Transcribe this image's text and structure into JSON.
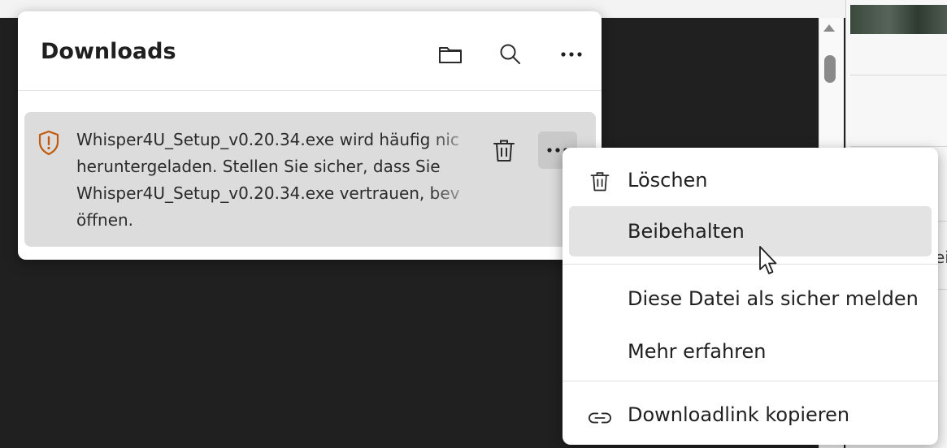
{
  "downloads": {
    "title": "Downloads",
    "header_buttons": [
      "open-folder-icon",
      "search-icon",
      "more-options-icon"
    ],
    "item": {
      "status_icon": "warning-shield-icon",
      "warning_lines": [
        "Whisper4U_Setup_v0.20.34.exe wird häufig nic",
        "heruntergeladen. Stellen Sie sicher, dass Sie",
        "Whisper4U_Setup_v0.20.34.exe vertrauen, bev",
        "öffnen."
      ],
      "delete_icon": "trash-icon",
      "more_icon": "more-options-icon"
    }
  },
  "context_menu": {
    "items": [
      {
        "icon": "trash-icon",
        "label": "Löschen"
      },
      {
        "icon": "",
        "label": "Beibehalten"
      },
      {
        "icon": "",
        "label": "Diese Datei als sicher melden"
      },
      {
        "icon": "",
        "label": "Mehr erfahren"
      },
      {
        "icon": "link-icon",
        "label": "Downloadlink kopieren"
      }
    ],
    "hovered_item": "Beibehalten"
  },
  "background": {
    "cut_off_text": "ei"
  },
  "colors": {
    "warning": "#c2590b",
    "item_background": "#dcdcdc",
    "hover_background": "#e3e3e3"
  }
}
